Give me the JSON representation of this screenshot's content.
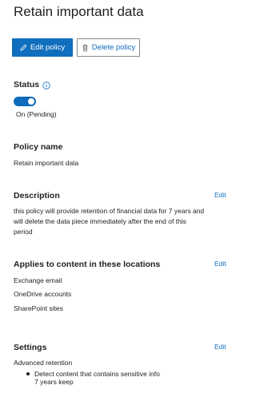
{
  "page": {
    "title": "Retain important data"
  },
  "toolbar": {
    "edit_label": "Edit policy",
    "edit_icon": "pencil-icon",
    "delete_label": "Delete policy",
    "delete_icon": "trash-icon"
  },
  "status": {
    "heading": "Status",
    "info_icon": "info-icon",
    "toggle_on": true,
    "value": "On (Pending)"
  },
  "policy_name": {
    "heading": "Policy name",
    "value": "Retain important data"
  },
  "description": {
    "heading": "Description",
    "edit_label": "Edit",
    "lines": [
      "this policy will provide retention of financial data for 7 years and",
      "will delete the data piece immediately after the end of this",
      "period"
    ]
  },
  "locations": {
    "heading": "Applies to content in these locations",
    "edit_label": "Edit",
    "items": [
      "Exchange email",
      "OneDrive accounts",
      "SharePoint sites"
    ]
  },
  "settings": {
    "heading": "Settings",
    "edit_label": "Edit",
    "label": "Advanced retention",
    "bullets": [
      "Detect content that contains sensitive info"
    ],
    "detail": "7 years keep"
  },
  "colors": {
    "accent": "#0f6cbd",
    "primary_button": "#106ebe",
    "text": "#201f1e"
  }
}
